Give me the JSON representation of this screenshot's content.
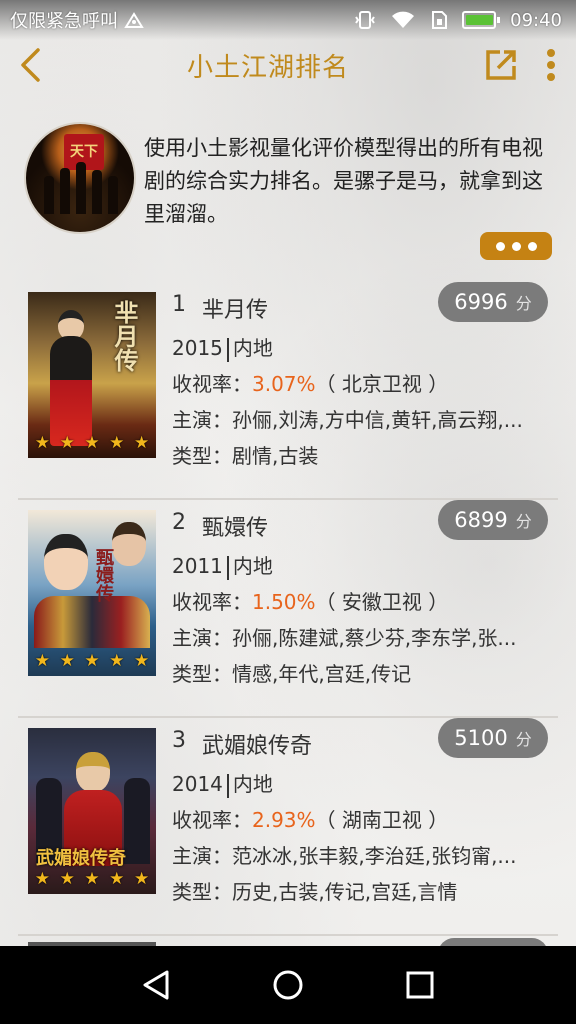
{
  "status_bar": {
    "carrier_text": "仅限紧急呼叫",
    "battery_text": "",
    "time": "09:40"
  },
  "header": {
    "title": "小土江湖排名",
    "back_icon": "chevron-left-icon",
    "share_icon": "external-link-icon",
    "more_icon": "vertical-dots-icon"
  },
  "intro": {
    "description": "使用小土影视量化评价模型得出的所有电视剧的综合实力排名。是骡子是马，就拿到这里溜溜。",
    "more_icon": "more-dots-icon"
  },
  "items": [
    {
      "rank": "1",
      "title": "芈月传",
      "score": "6996",
      "score_unit": "分",
      "year": "2015",
      "region": "内地",
      "rating_label": "收视率：",
      "rating_value": "3.07%",
      "channel": "（ 北京卫视 ）",
      "cast_label": "主演：",
      "cast": "孙俪,刘涛,方中信,黄轩,高云翔,...",
      "genre_label": "类型：",
      "genre": "剧情,古装",
      "stars": 5
    },
    {
      "rank": "2",
      "title": "甄嬛传",
      "score": "6899",
      "score_unit": "分",
      "year": "2011",
      "region": "内地",
      "rating_label": "收视率：",
      "rating_value": "1.50%",
      "channel": "（ 安徽卫视 ）",
      "cast_label": "主演：",
      "cast": "孙俪,陈建斌,蔡少芬,李东学,张...",
      "genre_label": "类型：",
      "genre": "情感,年代,宫廷,传记",
      "stars": 5
    },
    {
      "rank": "3",
      "title": "武媚娘传奇",
      "score": "5100",
      "score_unit": "分",
      "year": "2014",
      "region": "内地",
      "rating_label": "收视率：",
      "rating_value": "2.93%",
      "channel": "（ 湖南卫视 ）",
      "cast_label": "主演：",
      "cast": "范冰冰,张丰毅,李治廷,张钧甯,...",
      "genre_label": "类型：",
      "genre": "历史,古装,传记,宫廷,言情",
      "stars": 5
    }
  ],
  "nav_bar": {
    "back_icon": "triangle-back-icon",
    "home_icon": "circle-home-icon",
    "recents_icon": "square-recents-icon"
  },
  "colors": {
    "accent": "#c08a1d",
    "rating": "#e8641c",
    "score_pill": "#7b7b7b"
  }
}
